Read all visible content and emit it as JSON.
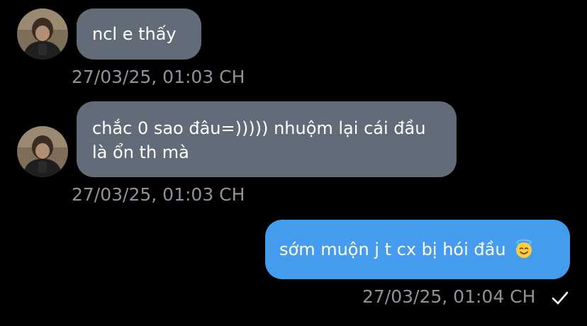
{
  "messages": [
    {
      "direction": "incoming",
      "text": "ncl e thấy",
      "timestamp": "27/03/25, 01:03 CH"
    },
    {
      "direction": "incoming",
      "text": "chắc 0 sao đâu=))))) nhuộm lại cái đầu là ổn th mà",
      "timestamp": "27/03/25, 01:03 CH"
    },
    {
      "direction": "outgoing",
      "text": "sớm muộn j t cx bị hói đầu",
      "emoji": "smiling-face-with-halo",
      "timestamp": "27/03/25, 01:04 CH",
      "status": "sent"
    }
  ],
  "colors": {
    "background": "#000000",
    "incoming_bubble": "#626c79",
    "outgoing_bubble": "#459cee",
    "timestamp": "#8e939b"
  }
}
